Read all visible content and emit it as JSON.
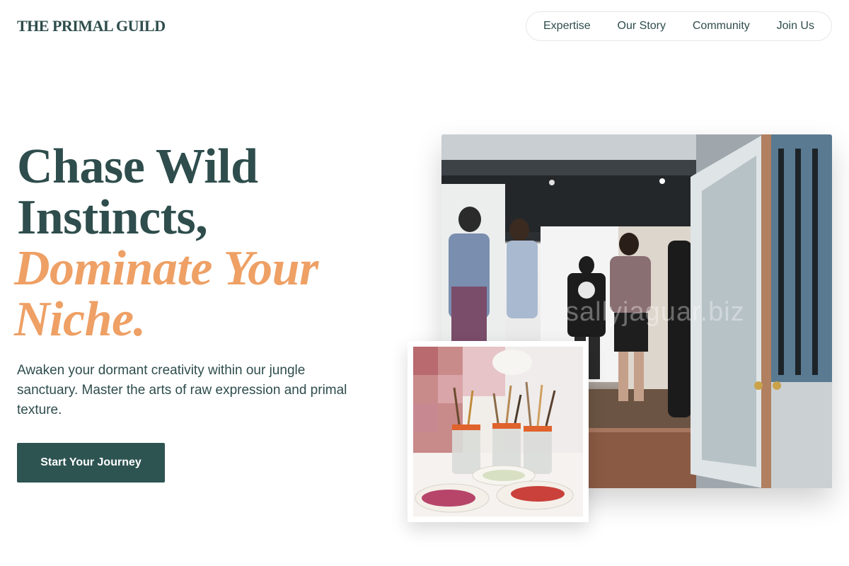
{
  "brand": {
    "name": "THE PRIMAL GUILD"
  },
  "nav": {
    "items": [
      {
        "label": "Expertise"
      },
      {
        "label": "Our Story"
      },
      {
        "label": "Community"
      },
      {
        "label": "Join Us"
      }
    ]
  },
  "hero": {
    "title_line1": "Chase Wild",
    "title_line2": "Instincts,",
    "title_accent1": "Dominate Your",
    "title_accent2": "Niche.",
    "subtitle": "Awaken your dormant creativity within our jungle sanctuary. Master the arts of raw expression and primal texture.",
    "cta_label": "Start Your Journey"
  },
  "images": {
    "main_watermark": "sallyjaguar.biz",
    "main_description_icon": "gallery-photo-icon",
    "small_description_icon": "paint-brushes-photo-icon"
  },
  "colors": {
    "primary": "#2e4d4c",
    "accent": "#eea065",
    "button": "#2e5452"
  }
}
